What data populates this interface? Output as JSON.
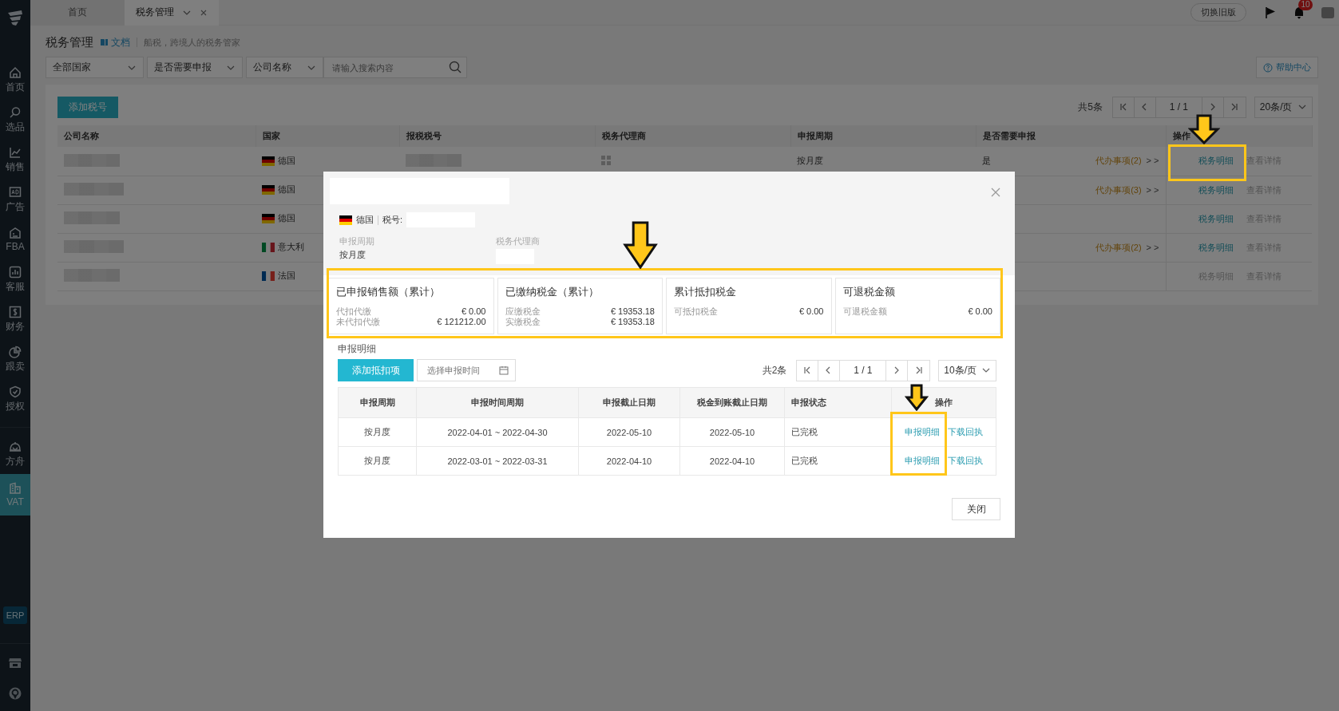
{
  "sidebar": {
    "items": [
      {
        "label": "首页",
        "selected": false
      },
      {
        "label": "选品",
        "selected": false
      },
      {
        "label": "销售",
        "selected": false
      },
      {
        "label": "广告",
        "selected": false
      },
      {
        "label": "FBA",
        "selected": false
      },
      {
        "label": "客服",
        "selected": false
      },
      {
        "label": "财务",
        "selected": false
      },
      {
        "label": "跟卖",
        "selected": false
      },
      {
        "label": "授权",
        "selected": false
      },
      {
        "label": "方舟",
        "selected": false
      },
      {
        "label": "VAT",
        "selected": true
      }
    ],
    "erp": "ERP"
  },
  "top_bar": {
    "tabs": [
      {
        "label": "首页",
        "selected": false,
        "closable": false
      },
      {
        "label": "税务管理",
        "selected": true,
        "closable": true
      }
    ],
    "switch_button": "切换旧版",
    "notification_count": "10"
  },
  "page": {
    "title": "税务管理",
    "doc_link": "文档",
    "subtitle": "船税，跨境人的税务管家",
    "filters": [
      {
        "label": "全部国家"
      },
      {
        "label": "是否需要申报"
      },
      {
        "label": "公司名称"
      }
    ],
    "search": {
      "placeholder": "请输入搜索内容"
    },
    "help_button": "帮助中心",
    "add_button": "添加税号",
    "total": "共5条",
    "pager": "1 / 1",
    "page_size": "20条/页"
  },
  "table": {
    "columns": [
      "公司名称",
      "国家",
      "报税税号",
      "税务代理商",
      "申报周期",
      "是否需要申报",
      "操作"
    ],
    "rows": [
      {
        "country": "德国",
        "flag": {
          "kind": "de"
        },
        "period": "按月度",
        "needs_filing": "是",
        "todo": "代办事项(2)",
        "todo_arrow": "> >",
        "actions": [
          {
            "label": "税务明细",
            "disabled": false
          },
          {
            "label": "查看详情",
            "disabled": true
          }
        ]
      },
      {
        "country": "德国",
        "flag": {
          "kind": "de"
        },
        "todo": "代办事项(3)",
        "todo_arrow": "> >",
        "actions": [
          {
            "label": "税务明细",
            "disabled": false
          },
          {
            "label": "查看详情",
            "disabled": true
          }
        ]
      },
      {
        "country": "德国",
        "flag": {
          "kind": "de"
        },
        "actions": [
          {
            "label": "税务明细",
            "disabled": false
          },
          {
            "label": "查看详情",
            "disabled": true
          }
        ]
      },
      {
        "country": "意大利",
        "flag": {
          "kind": "it"
        },
        "todo": "代办事项(2)",
        "todo_arrow": "> >",
        "actions": [
          {
            "label": "税务明细",
            "disabled": false
          },
          {
            "label": "查看详情",
            "disabled": true
          }
        ]
      },
      {
        "country": "法国",
        "flag": {
          "kind": "fr"
        },
        "actions": [
          {
            "label": "税务明细",
            "disabled": true
          },
          {
            "label": "查看详情",
            "disabled": true
          }
        ]
      }
    ]
  },
  "dialog": {
    "country": "德国",
    "flag": {
      "kind": "de"
    },
    "tax_no_label": "税号:",
    "fields": [
      {
        "label": "申报周期",
        "value": "按月度"
      },
      {
        "label": "税务代理商"
      }
    ],
    "stats": [
      {
        "title": "已申报销售额（累计）",
        "lines": [
          {
            "label": "代扣代缴",
            "value": "€ 0.00"
          },
          {
            "label": "未代扣代缴",
            "value": "€ 121212.00"
          }
        ]
      },
      {
        "title": "已缴纳税金（累计）",
        "lines": [
          {
            "label": "应缴税金",
            "value": "€ 19353.18"
          },
          {
            "label": "实缴税金",
            "value": "€ 19353.18"
          }
        ]
      },
      {
        "title": "累计抵扣税金",
        "lines": [
          {
            "label": "可抵扣税金",
            "value": "€ 0.00"
          }
        ]
      },
      {
        "title": "可退税金额",
        "lines": [
          {
            "label": "可退税金额",
            "value": "€ 0.00"
          }
        ]
      }
    ],
    "section_title": "申报明细",
    "add_button": "添加抵扣项",
    "date_picker": {
      "placeholder": "选择申报时间"
    },
    "total": "共2条",
    "pager": "1 / 1",
    "page_size": "10条/页",
    "table": {
      "columns": [
        "申报周期",
        "申报时间周期",
        "申报截止日期",
        "税金到账截止日期",
        "申报状态",
        "操作"
      ],
      "rows": [
        {
          "cells": [
            "按月度",
            "2022-04-01 ~ 2022-04-30",
            "2022-05-10",
            "2022-05-10",
            "已完税"
          ],
          "actions": [
            "申报明细",
            "下载回执"
          ]
        },
        {
          "cells": [
            "按月度",
            "2022-03-01 ~ 2022-03-31",
            "2022-04-10",
            "2022-04-10",
            "已完税"
          ],
          "actions": [
            "申报明细",
            "下载回执"
          ]
        }
      ]
    },
    "close_button": "关闭"
  }
}
